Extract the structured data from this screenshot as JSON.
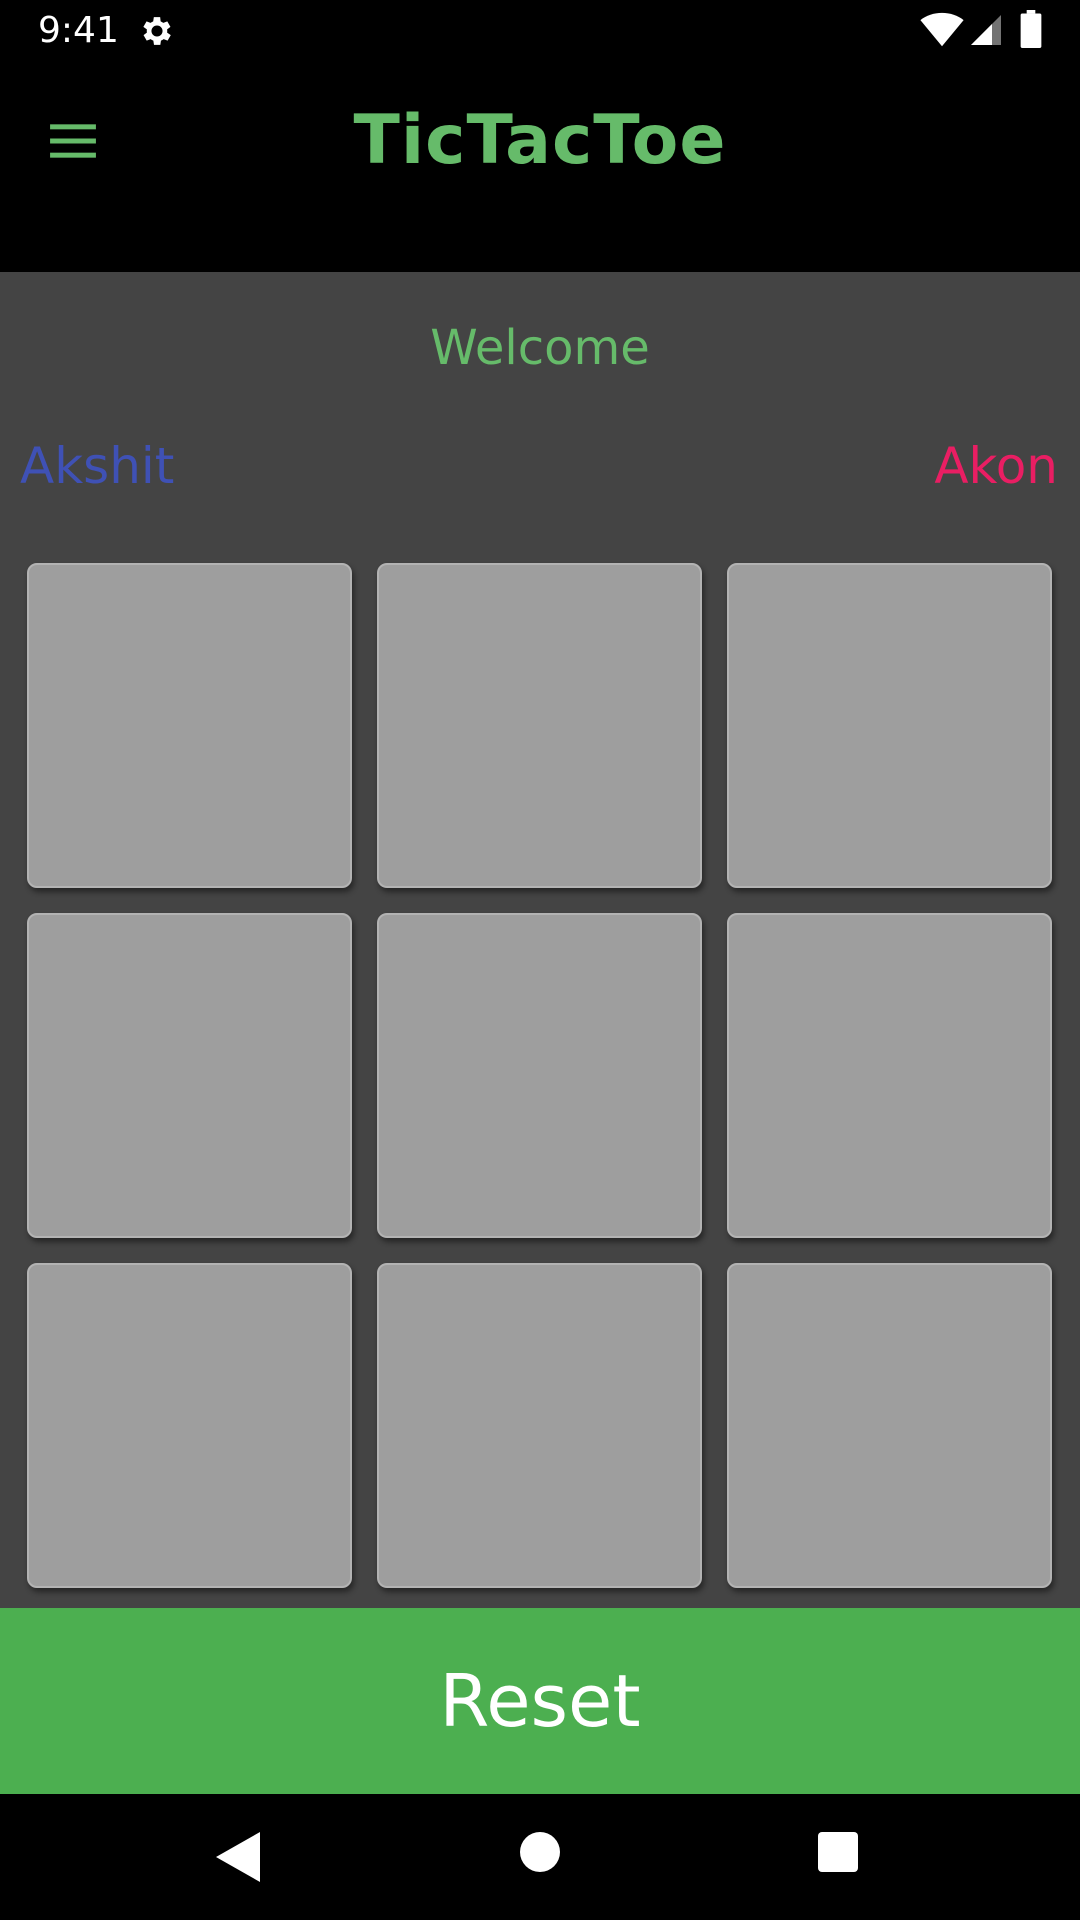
{
  "status_bar": {
    "time": "9:41",
    "icons": [
      "gear-icon",
      "wifi-icon",
      "signal-icon",
      "battery-icon"
    ]
  },
  "app_bar": {
    "title": "TicTacToe",
    "menu_icon": "menu-icon"
  },
  "main": {
    "welcome_text": "Welcome",
    "player1_name": "Akshit",
    "player2_name": "Akon",
    "board": {
      "cells": [
        "",
        "",
        "",
        "",
        "",
        "",
        "",
        "",
        ""
      ]
    }
  },
  "reset_label": "Reset",
  "nav_bar": {
    "icons": [
      "back-icon",
      "home-icon",
      "recents-icon"
    ]
  },
  "colors": {
    "accent_green": "#66bb6a",
    "button_green": "#4caf50",
    "player1": "#3f51b5",
    "player2": "#e91e63",
    "background": "#444444",
    "cell": "#9e9e9e"
  }
}
